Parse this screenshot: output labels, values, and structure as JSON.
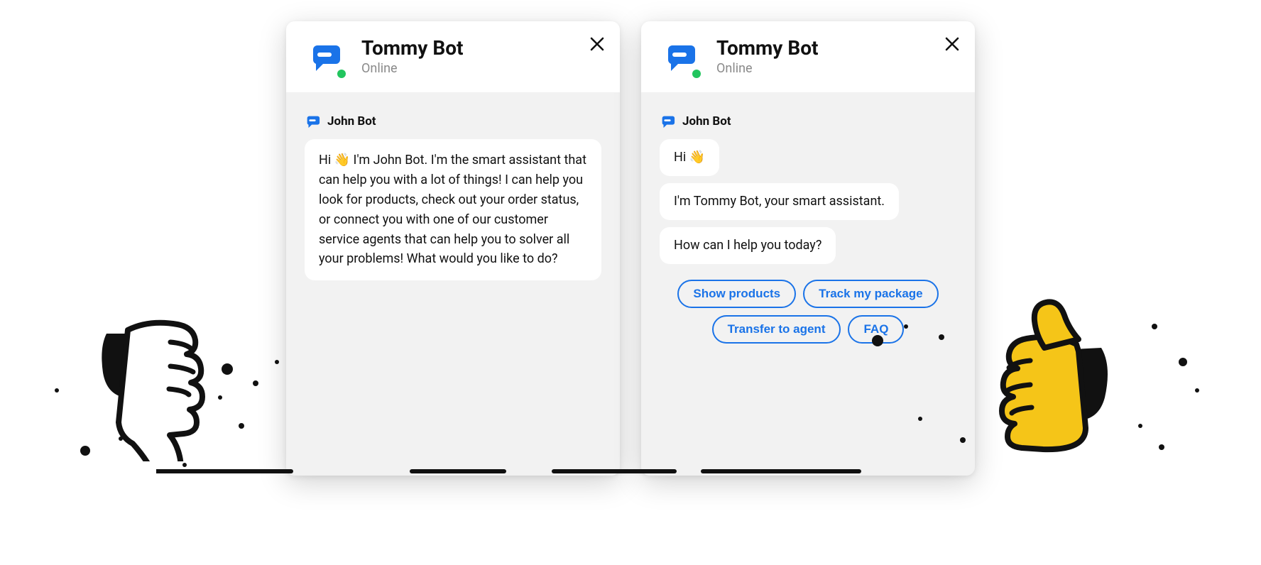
{
  "widget_left": {
    "title": "Tommy Bot",
    "status": "Online",
    "sender": "John Bot",
    "messages": [
      "Hi 👋 I'm John Bot. I'm the smart assistant that can help you with a lot of things! I can help you look for products, check out your order status, or connect you with one of our customer service agents that can help you to solver all your problems! What would you like to do?"
    ]
  },
  "widget_right": {
    "title": "Tommy Bot",
    "status": "Online",
    "sender": "John Bot",
    "messages": [
      "Hi 👋",
      "I'm Tommy Bot, your smart assistant.",
      "How can I help you today?"
    ],
    "quick_replies": [
      "Show products",
      "Track my package",
      "Transfer to agent",
      "FAQ"
    ]
  },
  "colors": {
    "brand_blue": "#1a73e8",
    "online_green": "#22c55e",
    "thumb_yellow": "#f5c518"
  }
}
